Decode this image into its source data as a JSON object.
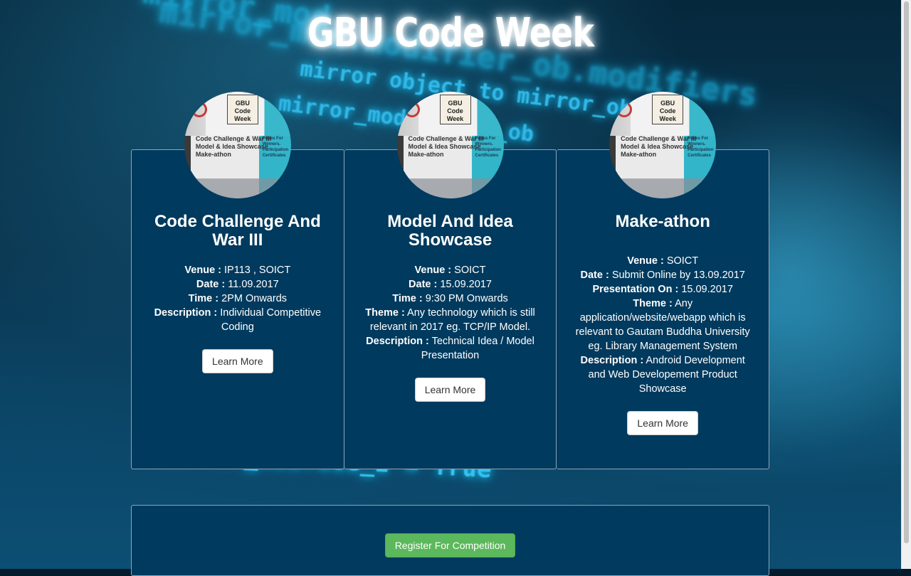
{
  "page": {
    "title": "GBU Code Week"
  },
  "background": {
    "code_lines": [
      "mirror_mod",
      "mirror_mod.modifier_ob.modifiers",
      "mirror object to mirror_ob",
      "mirror_mod.mirror_ob",
      "mirror_mod.use_z = True",
      ""
    ]
  },
  "poster": {
    "badge": "GBU\nCode Week",
    "lines": [
      "Code Challenge & War III",
      "Model & Idea Showcase",
      "Make-athon"
    ],
    "side": "Prizes For Winners. Participation Certificates"
  },
  "cards": [
    {
      "title": "Code Challenge And War III",
      "rows": [
        {
          "label": "Venue :",
          "value": " IP113 , SOICT"
        },
        {
          "label": "Date :",
          "value": " 11.09.2017"
        },
        {
          "label": "Time :",
          "value": " 2PM Onwards"
        },
        {
          "label": "Description :",
          "value": " Individual Competitive Coding"
        }
      ],
      "button": "Learn More"
    },
    {
      "title": "Model And Idea Showcase",
      "rows": [
        {
          "label": "Venue :",
          "value": " SOICT"
        },
        {
          "label": "Date :",
          "value": " 15.09.2017"
        },
        {
          "label": "Time :",
          "value": " 9:30 PM Onwards"
        },
        {
          "label": "Theme :",
          "value": " Any technology which is still relevant in 2017 eg. TCP/IP Model."
        },
        {
          "label": "Description :",
          "value": " Technical Idea / Model Presentation"
        }
      ],
      "button": "Learn More"
    },
    {
      "title": "Make-athon",
      "rows": [
        {
          "label": "Venue :",
          "value": " SOICT"
        },
        {
          "label": "Date :",
          "value": " Submit Online by 13.09.2017"
        },
        {
          "label": "Presentation On :",
          "value": " 15.09.2017"
        },
        {
          "label": "Theme :",
          "value": " Any application/website/webapp which is relevant to Gautam Buddha University eg. Library Management System"
        },
        {
          "label": "Description :",
          "value": " Android Development and Web Developement Product Showcase"
        }
      ],
      "button": "Learn More"
    }
  ],
  "register": {
    "button": "Register For Competition",
    "color": "#5cb85c"
  },
  "colors": {
    "card_bg": "#003a5e",
    "title_glow": "#ffffff",
    "code_glow": "#1ec0f0"
  }
}
